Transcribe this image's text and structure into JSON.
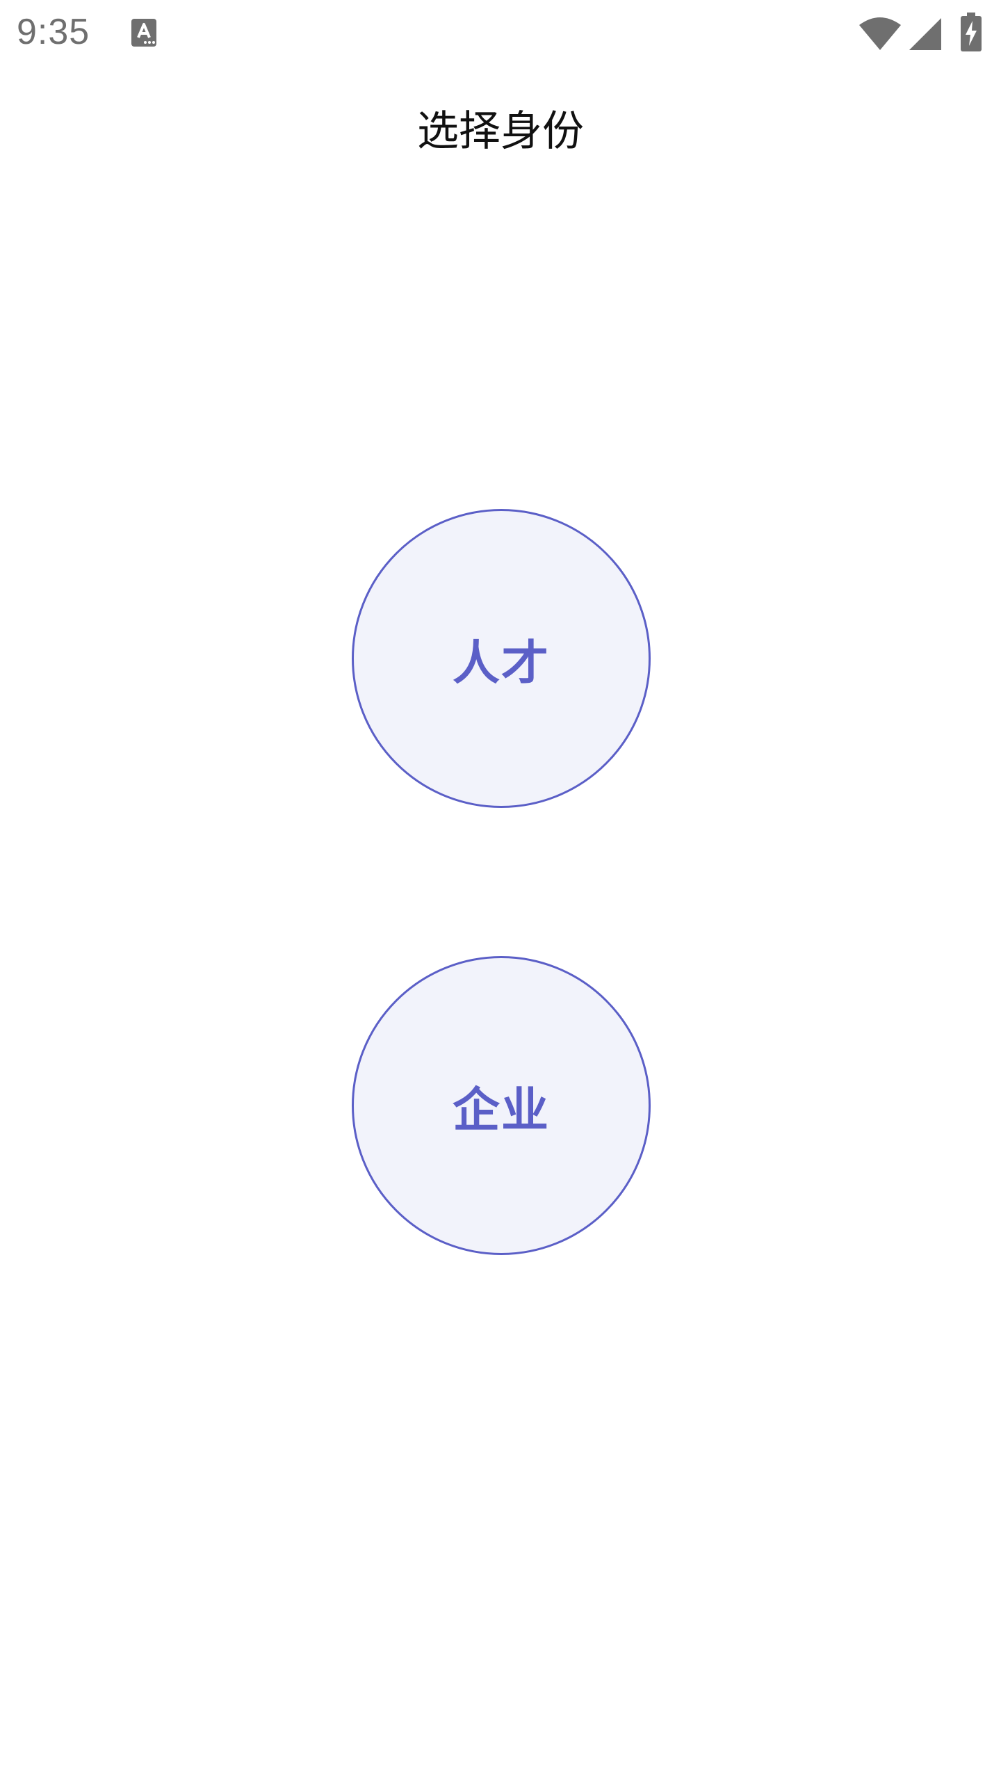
{
  "status_bar": {
    "time": "9:35",
    "icons": [
      "keyboard-icon",
      "wifi-icon",
      "signal-icon",
      "battery-charging-icon"
    ],
    "icon_color": "#6f6f6f"
  },
  "header": {
    "title": "选择身份"
  },
  "roles": [
    {
      "label": "人才"
    },
    {
      "label": "企业"
    }
  ],
  "colors": {
    "accent": "#5b5fc7",
    "button_fill": "#f2f3fb",
    "background": "#ffffff"
  }
}
